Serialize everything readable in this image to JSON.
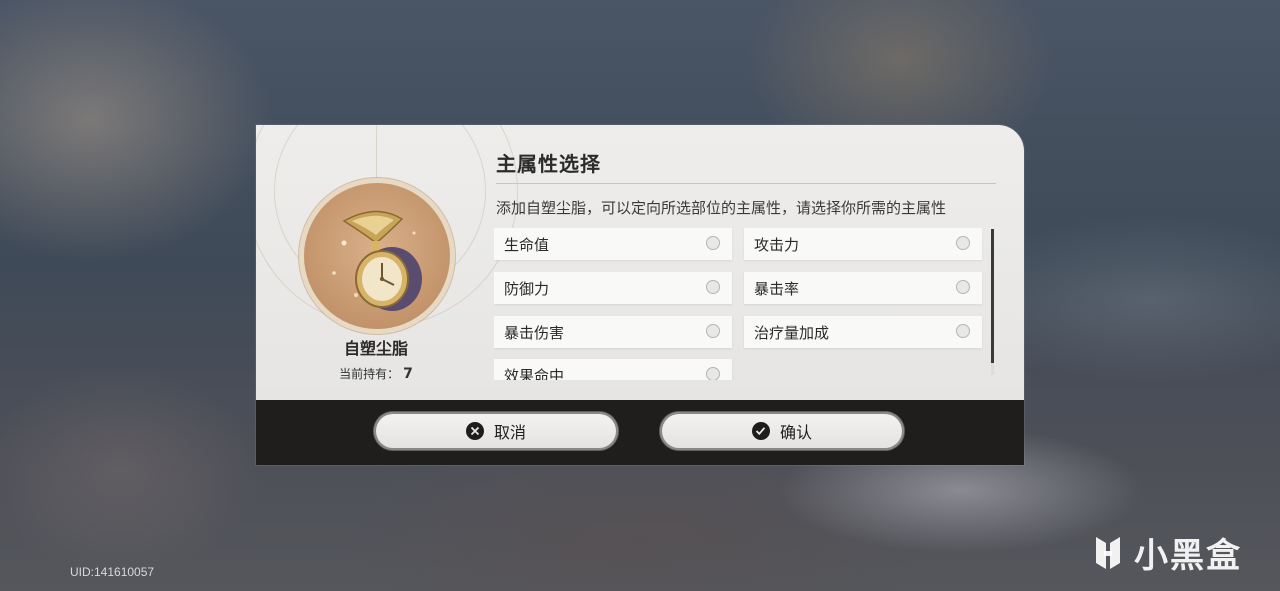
{
  "dialog": {
    "title": "主属性选择",
    "description": "添加自塑尘脂，可以定向所选部位的主属性，请选择你所需的主属性",
    "item": {
      "name": "自塑尘脂",
      "count_label": "当前持有：",
      "count_value": "7",
      "icon": "hourglass-pocket-watch-icon"
    },
    "options": [
      {
        "label": "生命值",
        "selected": false
      },
      {
        "label": "攻击力",
        "selected": false
      },
      {
        "label": "防御力",
        "selected": false
      },
      {
        "label": "暴击率",
        "selected": false
      },
      {
        "label": "暴击伤害",
        "selected": false
      },
      {
        "label": "治疗量加成",
        "selected": false
      },
      {
        "label": "效果命中",
        "selected": false
      }
    ],
    "buttons": {
      "cancel_label": "取消",
      "confirm_label": "确认"
    }
  },
  "footer": {
    "uid": "UID:141610057"
  },
  "watermark": {
    "text": "小黑盒"
  },
  "colors": {
    "dialog_bg": "#eeedeb",
    "footer_bg": "#1f1e1d",
    "accent_text": "#2b2b2b"
  }
}
